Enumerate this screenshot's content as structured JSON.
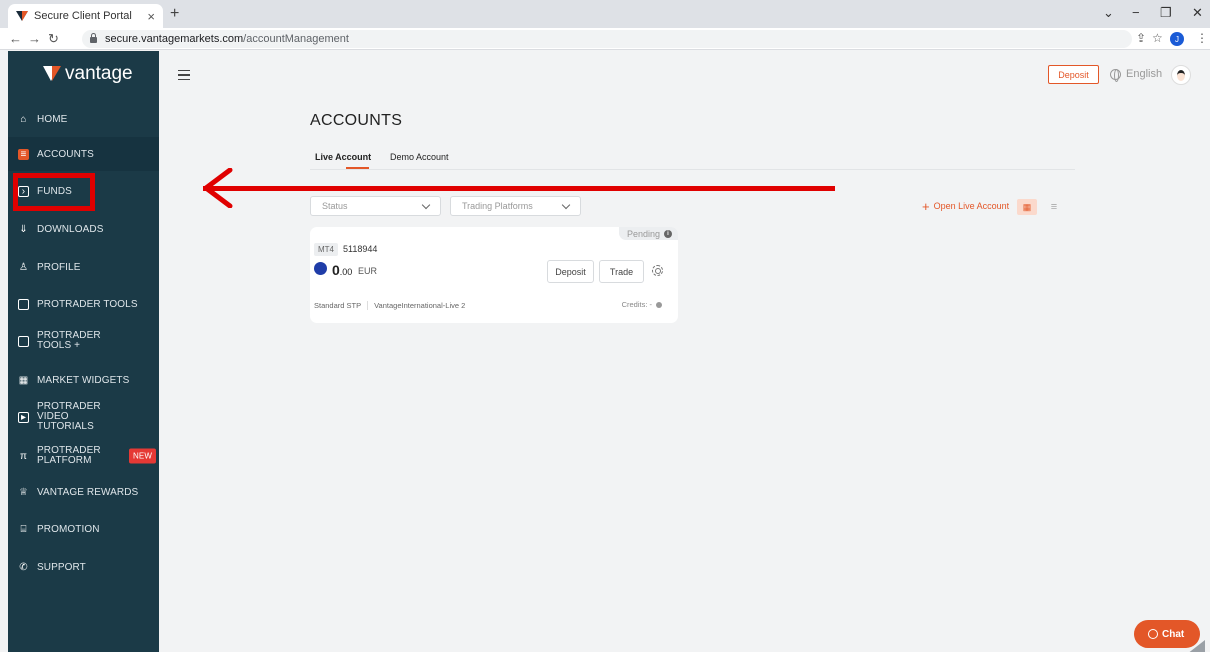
{
  "browser": {
    "tab_title": "Secure Client Portal",
    "tab_close": "×",
    "new_tab": "+",
    "url_host": "secure.vantagemarkets.com",
    "url_path": "/accountManagement",
    "profile_initial": "J"
  },
  "brand": {
    "logo_text": "vantage"
  },
  "sidebar": {
    "items": [
      {
        "label": "HOME",
        "icon": "home-icon"
      },
      {
        "label": "ACCOUNTS",
        "icon": "accounts-icon"
      },
      {
        "label": "FUNDS",
        "icon": "funds-icon"
      },
      {
        "label": "DOWNLOADS",
        "icon": "download-icon"
      },
      {
        "label": "PROFILE",
        "icon": "profile-icon"
      },
      {
        "label": "PROTRADER TOOLS",
        "icon": "briefcase-icon"
      },
      {
        "label": "PROTRADER TOOLS +",
        "icon": "briefcase-icon"
      },
      {
        "label": "MARKET WIDGETS",
        "icon": "widgets-icon"
      },
      {
        "label": "PROTRADER VIDEO TUTORIALS",
        "icon": "video-icon"
      },
      {
        "label": "PROTRADER PLATFORM",
        "icon": "platform-icon",
        "badge": "NEW"
      },
      {
        "label": "VANTAGE REWARDS",
        "icon": "rewards-icon"
      },
      {
        "label": "PROMOTION",
        "icon": "gift-icon"
      },
      {
        "label": "SUPPORT",
        "icon": "support-icon"
      }
    ]
  },
  "header": {
    "deposit_label": "Deposit",
    "language": "English"
  },
  "main": {
    "title": "ACCOUNTS",
    "tabs": [
      {
        "label": "Live Account"
      },
      {
        "label": "Demo Account"
      }
    ],
    "filters": {
      "status": "Status",
      "platforms": "Trading Platforms"
    },
    "open_live_label": "Open Live Account",
    "card": {
      "status": "Pending",
      "platform": "MT4",
      "account_number": "5118944",
      "balance_int": "0",
      "balance_dec": ".00",
      "currency": "EUR",
      "deposit_label": "Deposit",
      "trade_label": "Trade",
      "account_type": "Standard STP",
      "server": "VantageInternational-Live 2",
      "credits": "Credits: -"
    }
  },
  "chat": {
    "label": "Chat"
  },
  "colors": {
    "accent": "#e35728",
    "sidebar": "#1b3a47",
    "annotation": "#e00000"
  }
}
